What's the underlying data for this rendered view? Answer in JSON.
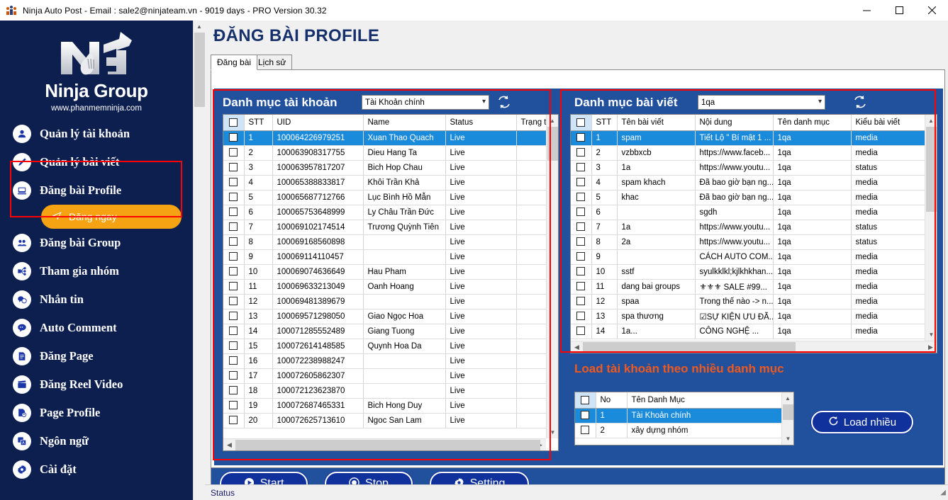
{
  "window": {
    "title": "Ninja Auto Post - Email : sale2@ninjateam.vn - 9019 days -  PRO Version 30.32",
    "app_icon": "ninja-app-icon",
    "minimize": "–",
    "maximize": "☐",
    "close": "✕"
  },
  "sidebar": {
    "brand_name": "Ninja Group",
    "brand_url": "www.phanmemninja.com",
    "logo": "ninja-group-logo",
    "items": [
      {
        "label": "Quản lý tài khoản",
        "icon": "user-icon"
      },
      {
        "label": "Quản lý bài viết",
        "icon": "pen-icon"
      },
      {
        "label": "Đăng bài Profile",
        "icon": "monitor-icon"
      },
      {
        "label": "Đăng bài Group",
        "icon": "group-icon"
      },
      {
        "label": "Tham gia nhóm",
        "icon": "network-icon"
      },
      {
        "label": "Nhắn tin",
        "icon": "chat-icon"
      },
      {
        "label": "Auto Comment",
        "icon": "comment-icon"
      },
      {
        "label": "Đăng Page",
        "icon": "document-icon"
      },
      {
        "label": "Đăng Reel Video",
        "icon": "clapperboard-icon"
      },
      {
        "label": "Page Profile",
        "icon": "page-profile-icon"
      },
      {
        "label": "Ngôn ngữ",
        "icon": "language-icon"
      },
      {
        "label": "Cài đặt",
        "icon": "gear-icon"
      }
    ],
    "sub_item": {
      "label": "Đăng ngay",
      "icon": "send-icon"
    }
  },
  "main": {
    "page_title": "ĐĂNG BÀI PROFILE",
    "tabs": [
      {
        "label": "Đăng bài",
        "active": true
      },
      {
        "label": "Lịch sử",
        "active": false
      }
    ]
  },
  "accounts_panel": {
    "title": "Danh mục tài khoản",
    "category_value": "Tài Khoản chính",
    "refresh_icon": "refresh-icon",
    "columns": [
      "",
      "STT",
      "UID",
      "Name",
      "Status",
      "Trạng thái"
    ],
    "rows": [
      {
        "stt": "1",
        "uid": "100064226979251",
        "name": "Xuan Thao Quach",
        "status": "Live",
        "trangthai": "",
        "selected": true
      },
      {
        "stt": "2",
        "uid": "100063908317755",
        "name": "Dieu Hang Ta",
        "status": "Live",
        "trangthai": "",
        "selected": false
      },
      {
        "stt": "3",
        "uid": "100063957817207",
        "name": "Bich Hop Chau",
        "status": "Live",
        "trangthai": "",
        "selected": false
      },
      {
        "stt": "4",
        "uid": "100065388833817",
        "name": "Khôi Trần Khả",
        "status": "Live",
        "trangthai": "",
        "selected": false
      },
      {
        "stt": "5",
        "uid": "100065687712766",
        "name": "Lục Bình Hồ Mẫn",
        "status": "Live",
        "trangthai": "",
        "selected": false
      },
      {
        "stt": "6",
        "uid": "100065753648999",
        "name": "Ly Châu Trần Đức",
        "status": "Live",
        "trangthai": "",
        "selected": false
      },
      {
        "stt": "7",
        "uid": "100069102174514",
        "name": "Trương Quỳnh Tiên",
        "status": "Live",
        "trangthai": "",
        "selected": false
      },
      {
        "stt": "8",
        "uid": "100069168560898",
        "name": "",
        "status": "Live",
        "trangthai": "",
        "selected": false
      },
      {
        "stt": "9",
        "uid": "100069114110457",
        "name": "",
        "status": "Live",
        "trangthai": "",
        "selected": false
      },
      {
        "stt": "10",
        "uid": "100069074636649",
        "name": "Hau Pham",
        "status": "Live",
        "trangthai": "",
        "selected": false
      },
      {
        "stt": "11",
        "uid": "100069633213049",
        "name": "Oanh Hoang",
        "status": "Live",
        "trangthai": "",
        "selected": false
      },
      {
        "stt": "12",
        "uid": "100069481389679",
        "name": "",
        "status": "Live",
        "trangthai": "",
        "selected": false
      },
      {
        "stt": "13",
        "uid": "100069571298050",
        "name": "Giao Ngọc Hoa",
        "status": "Live",
        "trangthai": "",
        "selected": false
      },
      {
        "stt": "14",
        "uid": "100071285552489",
        "name": "Giang Tuong",
        "status": "Live",
        "trangthai": "",
        "selected": false
      },
      {
        "stt": "15",
        "uid": "100072614148585",
        "name": "Quynh Hoa Da",
        "status": "Live",
        "trangthai": "",
        "selected": false
      },
      {
        "stt": "16",
        "uid": "100072238988247",
        "name": "",
        "status": "Live",
        "trangthai": "",
        "selected": false
      },
      {
        "stt": "17",
        "uid": "100072605862307",
        "name": "",
        "status": "Live",
        "trangthai": "",
        "selected": false
      },
      {
        "stt": "18",
        "uid": "100072123623870",
        "name": "",
        "status": "Live",
        "trangthai": "",
        "selected": false
      },
      {
        "stt": "19",
        "uid": "100072687465331",
        "name": "Bich Hong Duy",
        "status": "Live",
        "trangthai": "",
        "selected": false
      },
      {
        "stt": "20",
        "uid": "100072625713610",
        "name": "Ngoc San Lam",
        "status": "Live",
        "trangthai": "",
        "selected": false
      }
    ]
  },
  "posts_panel": {
    "title": "Danh mục bài viết",
    "category_value": "1qa",
    "refresh_icon": "refresh-icon",
    "columns": [
      "",
      "STT",
      "Tên bài viết",
      "Nội dung",
      "Tên danh mục",
      "Kiểu bài viết"
    ],
    "rows": [
      {
        "stt": "1",
        "ten": "spam",
        "noidung": "Tiết Lộ \" Bí mật 1 ...",
        "danhmuc": "1qa",
        "kieu": "media",
        "selected": true
      },
      {
        "stt": "2",
        "ten": "vzbbxcb",
        "noidung": "https://www.faceb...",
        "danhmuc": "1qa",
        "kieu": "media",
        "selected": false
      },
      {
        "stt": "3",
        "ten": "1a",
        "noidung": "https://www.youtu...",
        "danhmuc": "1qa",
        "kieu": "status",
        "selected": false
      },
      {
        "stt": "4",
        "ten": "spam khach",
        "noidung": "Đã bao giờ bạn ng...",
        "danhmuc": "1qa",
        "kieu": "media",
        "selected": false
      },
      {
        "stt": "5",
        "ten": "khac",
        "noidung": "Đã bao giờ bạn ng...",
        "danhmuc": "1qa",
        "kieu": "media",
        "selected": false
      },
      {
        "stt": "6",
        "ten": "",
        "noidung": "sgdh",
        "danhmuc": "1qa",
        "kieu": "media",
        "selected": false
      },
      {
        "stt": "7",
        "ten": "1a",
        "noidung": "https://www.youtu...",
        "danhmuc": "1qa",
        "kieu": "status",
        "selected": false
      },
      {
        "stt": "8",
        "ten": "2a",
        "noidung": "https://www.youtu...",
        "danhmuc": "1qa",
        "kieu": "status",
        "selected": false
      },
      {
        "stt": "9",
        "ten": "",
        "noidung": "CÁCH AUTO COM...",
        "danhmuc": "1qa",
        "kieu": "media",
        "selected": false
      },
      {
        "stt": "10",
        "ten": "sstf",
        "noidung": "syulkklkl;kjlkhkhan...",
        "danhmuc": "1qa",
        "kieu": "media",
        "selected": false
      },
      {
        "stt": "11",
        "ten": "dang bai groups",
        "noidung": "⚜⚜⚜ SALE  #99...",
        "danhmuc": "1qa",
        "kieu": "media",
        "selected": false
      },
      {
        "stt": "12",
        "ten": "spaa",
        "noidung": "Trong thế nào -> n...",
        "danhmuc": "1qa",
        "kieu": "media",
        "selected": false
      },
      {
        "stt": "13",
        "ten": "spa thương",
        "noidung": "☑SỰ KIỆN ƯU ĐÃ...",
        "danhmuc": "1qa",
        "kieu": "media",
        "selected": false
      },
      {
        "stt": "14",
        "ten": "1a...",
        "noidung": "CÔNG NGHỆ ...",
        "danhmuc": "1qa",
        "kieu": "media",
        "selected": false
      }
    ]
  },
  "load_section": {
    "title": "Load tài khoản theo nhiều danh mục",
    "columns": [
      "",
      "No",
      "Tên Danh Mục"
    ],
    "rows": [
      {
        "no": "1",
        "name": "Tài Khoản chính",
        "selected": true
      },
      {
        "no": "2",
        "name": "xây dựng nhóm",
        "selected": false
      }
    ],
    "button": {
      "label": "Load nhiều",
      "icon": "refresh-icon"
    }
  },
  "actions": [
    {
      "label": "Start",
      "icon": "play-icon"
    },
    {
      "label": "Stop",
      "icon": "stop-icon"
    },
    {
      "label": "Setting",
      "icon": "gear-icon"
    }
  ],
  "status_bar": {
    "text": "Status"
  },
  "colors": {
    "sidebar_bg": "#0d1f4e",
    "panel_blue": "#21509d",
    "accent_orange": "#f5a313",
    "highlight_red": "#ff0000",
    "selection_blue": "#1a8adb",
    "button_blue": "#10319b",
    "load_title_orange": "#f1591c",
    "title_navy": "#16306b"
  }
}
